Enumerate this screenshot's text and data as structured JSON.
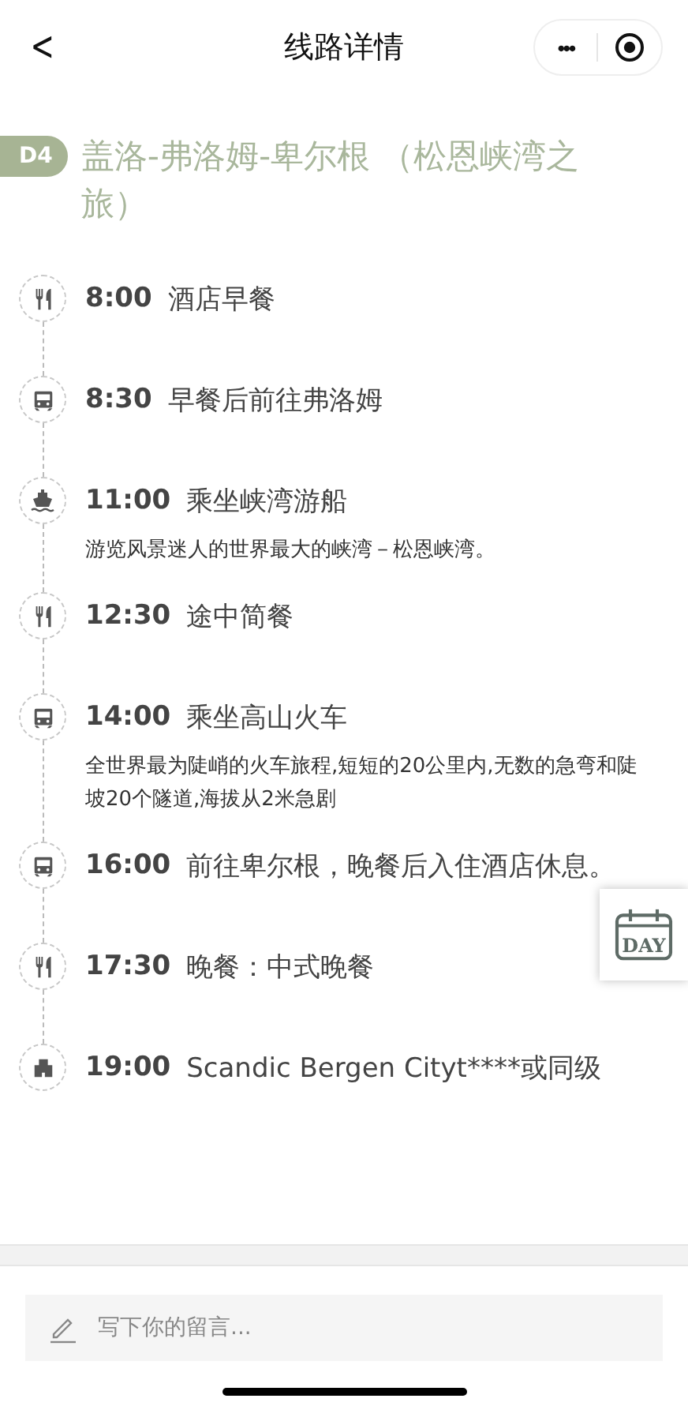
{
  "nav": {
    "back": "<",
    "title": "线路详情",
    "more": "•••"
  },
  "day": {
    "badge": "D4",
    "title": "盖洛-弗洛姆-卑尔根 （松恩峡湾之旅）"
  },
  "timeline": [
    {
      "kind": "meal",
      "time": "8:00",
      "title": "酒店早餐"
    },
    {
      "kind": "train",
      "time": "8:30",
      "title": "早餐后前往弗洛姆"
    },
    {
      "kind": "boat",
      "time": "11:00",
      "title": "乘坐峡湾游船",
      "description": "游览风景迷人的世界最大的峡湾－松恩峡湾。"
    },
    {
      "kind": "meal",
      "time": "12:30",
      "title": "途中简餐"
    },
    {
      "kind": "train",
      "time": "14:00",
      "title": "乘坐高山火车",
      "description": "全世界最为陡峭的火车旅程,短短的20公里内,无数的急弯和陡坡20个隧道,海拔从2米急剧"
    },
    {
      "kind": "train",
      "time": "16:00",
      "title": "前往卑尔根，晚餐后入住酒店休息。"
    },
    {
      "kind": "meal",
      "time": "17:30",
      "title": "晚餐：中式晚餐"
    },
    {
      "kind": "hotel",
      "time": "19:00",
      "title": "Scandic Bergen Cityt****或同级"
    }
  ],
  "day_button": "DAY",
  "comment": {
    "placeholder": "写下你的留言..."
  }
}
